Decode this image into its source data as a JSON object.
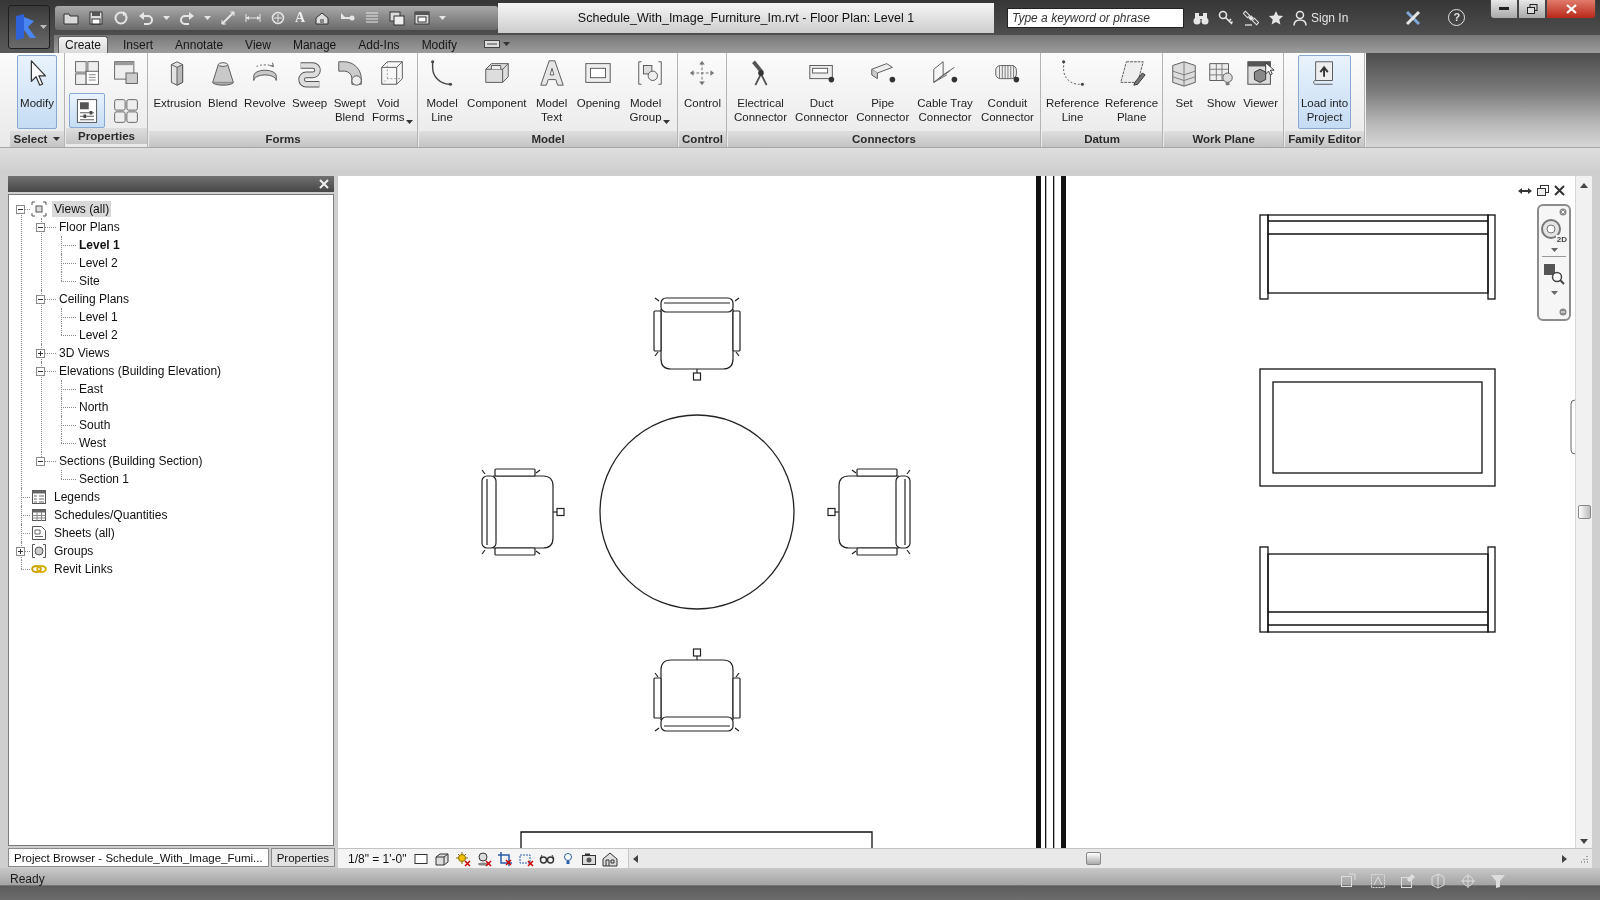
{
  "title_bar": {
    "text_tool": "A",
    "title": "Schedule_With_Image_Furniture_Im.rvt - Floor Plan: Level 1",
    "search": {
      "placeholder": "Type a keyword or phrase"
    },
    "sign_in": "Sign In",
    "help": "?"
  },
  "ribbon": {
    "tabs": [
      {
        "label": "Create",
        "selected": true
      },
      {
        "label": "Insert",
        "selected": false
      },
      {
        "label": "Annotate",
        "selected": false
      },
      {
        "label": "View",
        "selected": false
      },
      {
        "label": "Manage",
        "selected": false
      },
      {
        "label": "Add-Ins",
        "selected": false
      },
      {
        "label": "Modify",
        "selected": false
      }
    ],
    "panels": [
      {
        "label": "Select",
        "dropdown": true,
        "tools": [
          {
            "label": "Modify",
            "highlighted": true
          }
        ]
      },
      {
        "label": "Properties",
        "tools": [
          {
            "highlighted": false
          },
          {
            "highlighted": false
          },
          {
            "highlighted": true
          },
          {
            "highlighted": false
          }
        ]
      },
      {
        "label": "Forms",
        "tools": [
          {
            "label": "Extrusion",
            "highlighted": false
          },
          {
            "label": "Blend",
            "highlighted": false
          },
          {
            "label": "Revolve",
            "highlighted": false
          },
          {
            "label": "Sweep",
            "highlighted": false
          },
          {
            "label": "Swept\nBlend",
            "highlighted": false
          },
          {
            "label": "Void\nForms",
            "highlighted": false,
            "dropdown": true
          }
        ]
      },
      {
        "label": "Model",
        "tools": [
          {
            "label": "Model\nLine",
            "highlighted": false
          },
          {
            "label": "Component",
            "highlighted": false
          },
          {
            "label": "Model\nText",
            "highlighted": false
          },
          {
            "label": "Opening",
            "highlighted": false
          },
          {
            "label": "Model\nGroup",
            "highlighted": false,
            "dropdown": true
          }
        ]
      },
      {
        "label": "Control",
        "tools": [
          {
            "label": "Control",
            "highlighted": false
          }
        ]
      },
      {
        "label": "Connectors",
        "tools": [
          {
            "label": "Electrical\nConnector",
            "highlighted": false
          },
          {
            "label": "Duct\nConnector",
            "highlighted": false
          },
          {
            "label": "Pipe\nConnector",
            "highlighted": false
          },
          {
            "label": "Cable Tray\nConnector",
            "highlighted": false
          },
          {
            "label": "Conduit\nConnector",
            "highlighted": false
          }
        ]
      },
      {
        "label": "Datum",
        "tools": [
          {
            "label": "Reference\nLine",
            "highlighted": false
          },
          {
            "label": "Reference\nPlane",
            "highlighted": false
          }
        ]
      },
      {
        "label": "Work Plane",
        "tools": [
          {
            "label": "Set",
            "highlighted": false
          },
          {
            "label": "Show",
            "highlighted": false
          },
          {
            "label": "Viewer",
            "highlighted": false
          }
        ]
      },
      {
        "label": "Family Editor",
        "tools": [
          {
            "label": "Load into\nProject",
            "highlighted": true
          }
        ]
      }
    ]
  },
  "project_browser": {
    "tree": [
      {
        "label": "Views (all)",
        "kind": "views",
        "expanded": true,
        "selected": true,
        "current": false,
        "children": [
          {
            "label": "Floor Plans",
            "expanded": true,
            "selected": false,
            "current": false,
            "children": [
              {
                "label": "Level 1",
                "selected": false,
                "current": true
              },
              {
                "label": "Level 2",
                "selected": false,
                "current": false
              },
              {
                "label": "Site",
                "selected": false,
                "current": false
              }
            ]
          },
          {
            "label": "Ceiling Plans",
            "expanded": true,
            "selected": false,
            "current": false,
            "children": [
              {
                "label": "Level 1",
                "selected": false,
                "current": false
              },
              {
                "label": "Level 2",
                "selected": false,
                "current": false
              }
            ]
          },
          {
            "label": "3D Views",
            "expanded": false,
            "selected": false,
            "current": false
          },
          {
            "label": "Elevations (Building Elevation)",
            "expanded": true,
            "selected": false,
            "current": false,
            "children": [
              {
                "label": "East",
                "selected": false,
                "current": false
              },
              {
                "label": "North",
                "selected": false,
                "current": false
              },
              {
                "label": "South",
                "selected": false,
                "current": false
              },
              {
                "label": "West",
                "selected": false,
                "current": false
              }
            ]
          },
          {
            "label": "Sections (Building Section)",
            "expanded": true,
            "selected": false,
            "current": false,
            "children": [
              {
                "label": "Section 1",
                "selected": false,
                "current": false
              }
            ]
          }
        ]
      },
      {
        "label": "Legends",
        "kind": "legends",
        "selected": false,
        "current": false
      },
      {
        "label": "Schedules/Quantities",
        "kind": "schedules",
        "selected": false,
        "current": false
      },
      {
        "label": "Sheets (all)",
        "kind": "sheets",
        "selected": false,
        "current": false
      },
      {
        "label": "Groups",
        "kind": "groups",
        "expanded": false,
        "selected": false,
        "current": false
      },
      {
        "label": "Revit Links",
        "kind": "links",
        "selected": false,
        "current": false
      }
    ],
    "tabs": [
      {
        "label": "Project Browser - Schedule_With_Image_Fumi...",
        "selected": true
      },
      {
        "label": "Properties",
        "selected": false
      }
    ]
  },
  "view": {
    "wheel_badge": "2D",
    "scale": "1/8\" = 1'-0\""
  },
  "status_bar": {
    "text": "Ready"
  }
}
